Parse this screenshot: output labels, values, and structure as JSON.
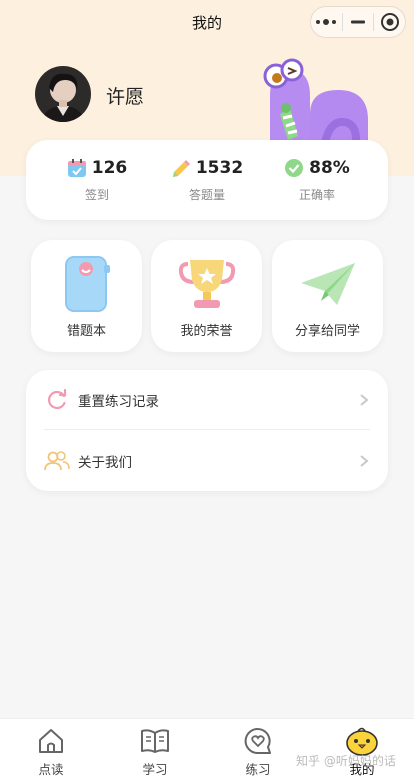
{
  "nav": {
    "title": "我的"
  },
  "profile": {
    "name": "许愿"
  },
  "stats": [
    {
      "value": "126",
      "label": "签到",
      "icon": "calendar-check-icon"
    },
    {
      "value": "1532",
      "label": "答题量",
      "icon": "pencil-icon"
    },
    {
      "value": "88%",
      "label": "正确率",
      "icon": "check-circle-icon"
    }
  ],
  "features": [
    {
      "label": "错题本",
      "icon": "notebook-icon"
    },
    {
      "label": "我的荣誉",
      "icon": "trophy-icon"
    },
    {
      "label": "分享给同学",
      "icon": "paper-plane-icon"
    }
  ],
  "menu": [
    {
      "label": "重置练习记录",
      "icon": "refresh-icon"
    },
    {
      "label": "关于我们",
      "icon": "users-icon"
    }
  ],
  "tabs": [
    {
      "label": "点读",
      "icon": "home-icon"
    },
    {
      "label": "学习",
      "icon": "book-icon"
    },
    {
      "label": "练习",
      "icon": "heart-chat-icon"
    },
    {
      "label": "我的",
      "icon": "chick-icon",
      "active": true
    }
  ],
  "watermark": "知乎 @听妈妈的话",
  "colors": {
    "header_bg": "#fdf0df",
    "accent_pink": "#f08aa0",
    "accent_purple": "#b58df0",
    "accent_green": "#8fd88a"
  }
}
